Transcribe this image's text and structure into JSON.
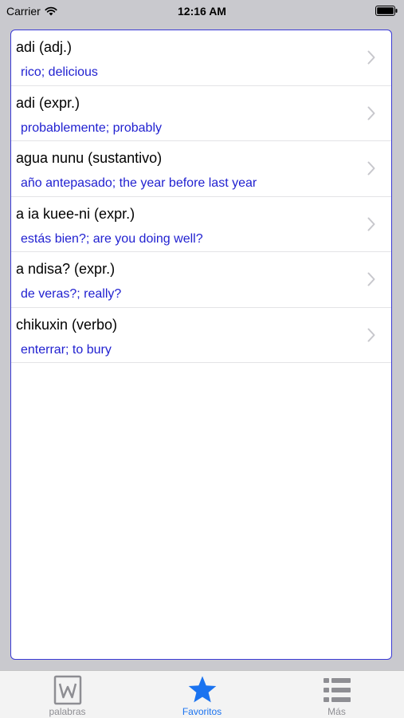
{
  "status_bar": {
    "carrier": "Carrier",
    "time": "12:16 AM"
  },
  "entries": [
    {
      "term": "adi (adj.)",
      "gloss": "rico; delicious"
    },
    {
      "term": "adi (expr.)",
      "gloss": "probablemente; probably"
    },
    {
      "term": "agua nunu (sustantivo)",
      "gloss": "año antepasado; the year before last year"
    },
    {
      "term": "a ia kuee-ni (expr.)",
      "gloss": "estás bien?; are you doing well?"
    },
    {
      "term": "a ndisa? (expr.)",
      "gloss": "de veras?; really?"
    },
    {
      "term": "chikuxin (verbo)",
      "gloss": "enterrar; to bury"
    }
  ],
  "tab_bar": {
    "tabs": [
      {
        "label": "palabras",
        "icon": "word-icon",
        "active": false
      },
      {
        "label": "Favoritos",
        "icon": "star-icon",
        "active": true
      },
      {
        "label": "Más",
        "icon": "list-icon",
        "active": false
      }
    ]
  },
  "colors": {
    "accent": "#1a73f0",
    "gloss_text": "#1f1fd0",
    "panel_border": "#3b3bd6",
    "inactive_tab": "#8e8e93"
  }
}
